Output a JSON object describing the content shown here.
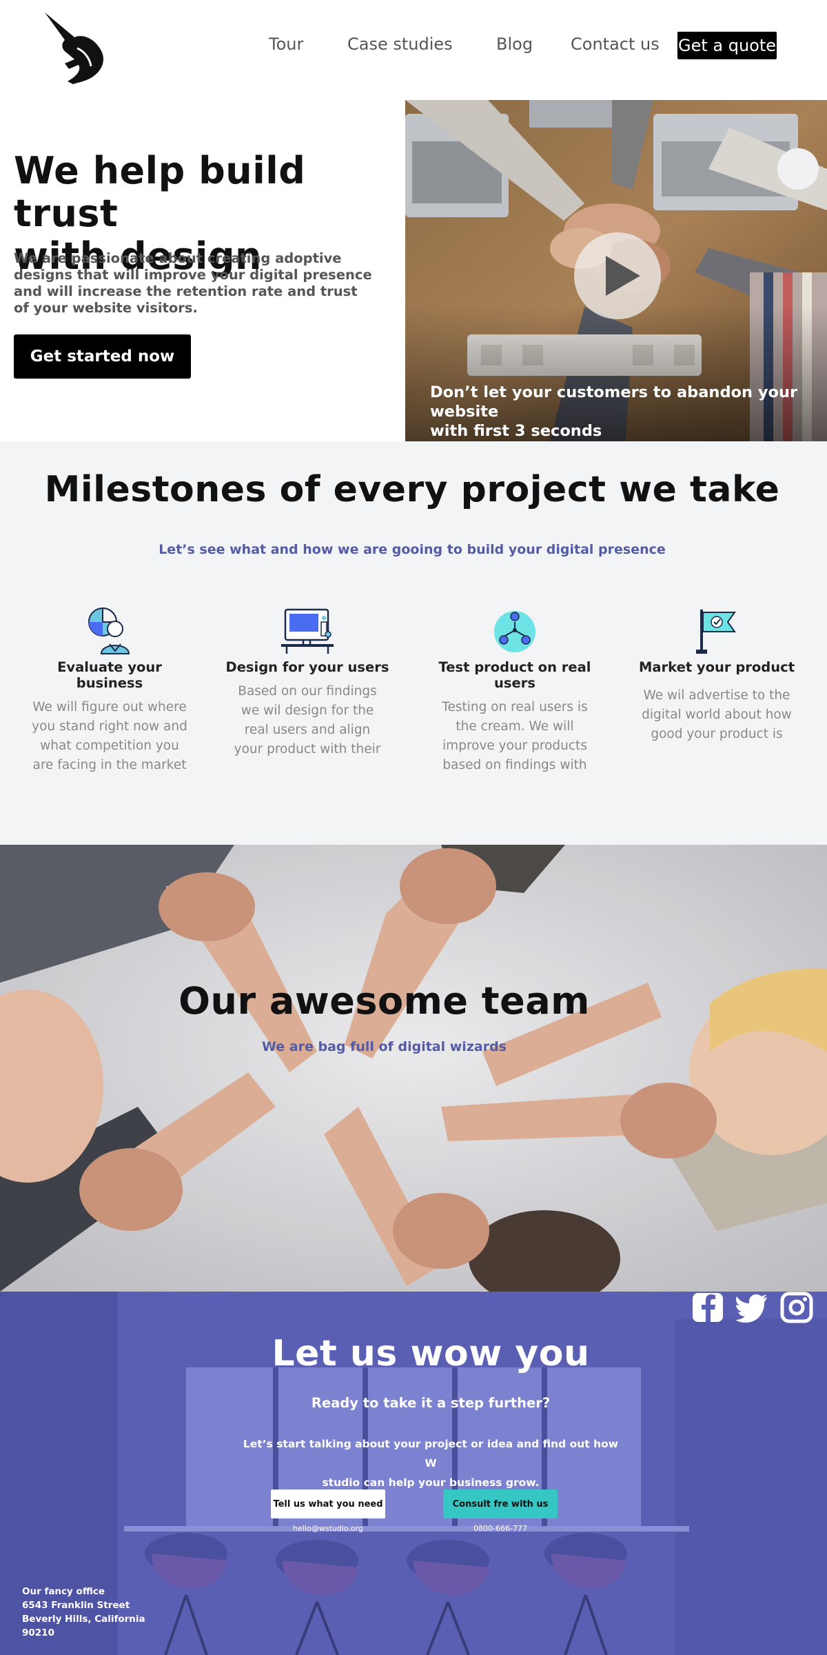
{
  "nav": {
    "links": [
      "Tour",
      "Case studies",
      "Blog",
      "Contact us"
    ],
    "quote_label": "Get a quote"
  },
  "hero": {
    "title_line1": "We help build trust",
    "title_line2": "with design",
    "description": "We are passionate about creating adoptive designs that will improve your digital presence and will increase the retention rate and trust of your website visitors.",
    "cta_label": "Get started now",
    "video_caption_line1": "Don’t let your customers to abandon your website",
    "video_caption_line2": "with first 3 seconds"
  },
  "milestones": {
    "title": "Milestones of every project we take",
    "subtitle": "Let’s see what and how we are gooing to build your digital presence",
    "items": [
      {
        "icon": "business-evaluation-icon",
        "title": "Evaluate your business",
        "lines": [
          "We will figure out where",
          "you stand right now and",
          "what competition you",
          "are facing in the market"
        ]
      },
      {
        "icon": "design-monitor-icon",
        "title": "Design for your users",
        "lines": [
          "Based on our findings",
          "we wil design for the",
          "real users and align",
          "your product with their"
        ]
      },
      {
        "icon": "user-network-icon",
        "title": "Test product on real users",
        "lines": [
          "Testing on real users is",
          "the cream. We will",
          "improve your products",
          "based on findings with"
        ]
      },
      {
        "icon": "flag-check-icon",
        "title": "Market your product",
        "lines": [
          "We wil advertise to the",
          "digital world about how",
          "good your product is"
        ]
      }
    ]
  },
  "team": {
    "title": "Our awesome team",
    "subtitle": "We are bag full of digital wizards"
  },
  "wow": {
    "title": "Let us wow you",
    "subtitle": "Ready to take it a step further?",
    "desc_line1": "Let’s start talking about your project or idea and find out how W",
    "desc_line2": "studio can help your business grow.",
    "button_left": "Tell us what you need",
    "button_right": "Consult fre with us",
    "email": "hello@wstudio.org",
    "phone": "0800-666-777",
    "office_lines": [
      "Our fancy office",
      "6543 Franklin Street",
      "Beverly Hills, California",
      "90210"
    ],
    "social": [
      "facebook-icon",
      "twitter-icon",
      "instagram-icon"
    ]
  },
  "colors": {
    "accent_purple": "#555aa5",
    "cta_teal": "#36c6c4",
    "footer_overlay": "#5a5fb3"
  }
}
